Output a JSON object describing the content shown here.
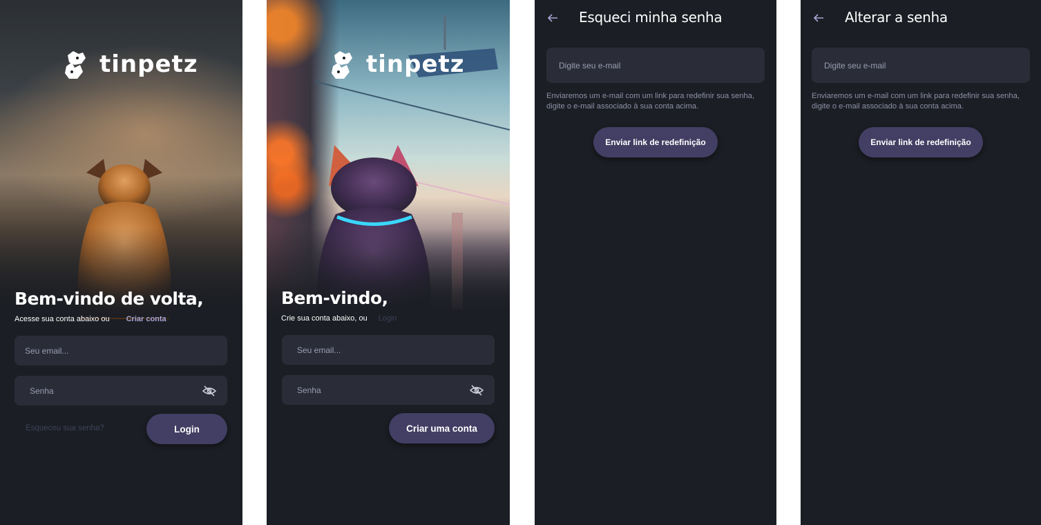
{
  "brand": {
    "name": "tinpetz",
    "logo_icon": "dog-and-cat-heads-icon"
  },
  "login_screen": {
    "title": "Bem-vindo de volta,",
    "subtitle": "Acesse sua conta abaixo ou",
    "create_account_link": "Criar conta",
    "email_placeholder": "Seu email...",
    "password_placeholder": "Senha",
    "forgot_password_link": "Esqueceu sua senha?",
    "login_button": "Login"
  },
  "signup_screen": {
    "title": "Bem-vindo,",
    "subtitle": "Crie sua conta abaixo, ou",
    "login_link": "Login",
    "email_placeholder": "Seu email...",
    "password_placeholder": "Senha",
    "create_account_button": "Criar uma conta"
  },
  "forgot_screen": {
    "title": "Esqueci minha senha",
    "email_placeholder": "Digite seu e-mail",
    "helper_text": "Enviaremos um e-mail com um link para redefinir sua senha, digite o e-mail associado à sua conta acima.",
    "send_button": "Enviar link de redefinição"
  },
  "change_screen": {
    "title": "Alterar a senha",
    "email_placeholder": "Digite seu e-mail",
    "helper_text": "Enviaremos um e-mail com um link para redefinir sua senha, digite o e-mail associado à sua conta acima.",
    "send_button": "Enviar link de redefinição"
  },
  "colors": {
    "background": "#1b1e24",
    "input": "#2a2d38",
    "button": "#433e63",
    "link": "#a9a6d6",
    "muted_link": "#3f4259"
  }
}
